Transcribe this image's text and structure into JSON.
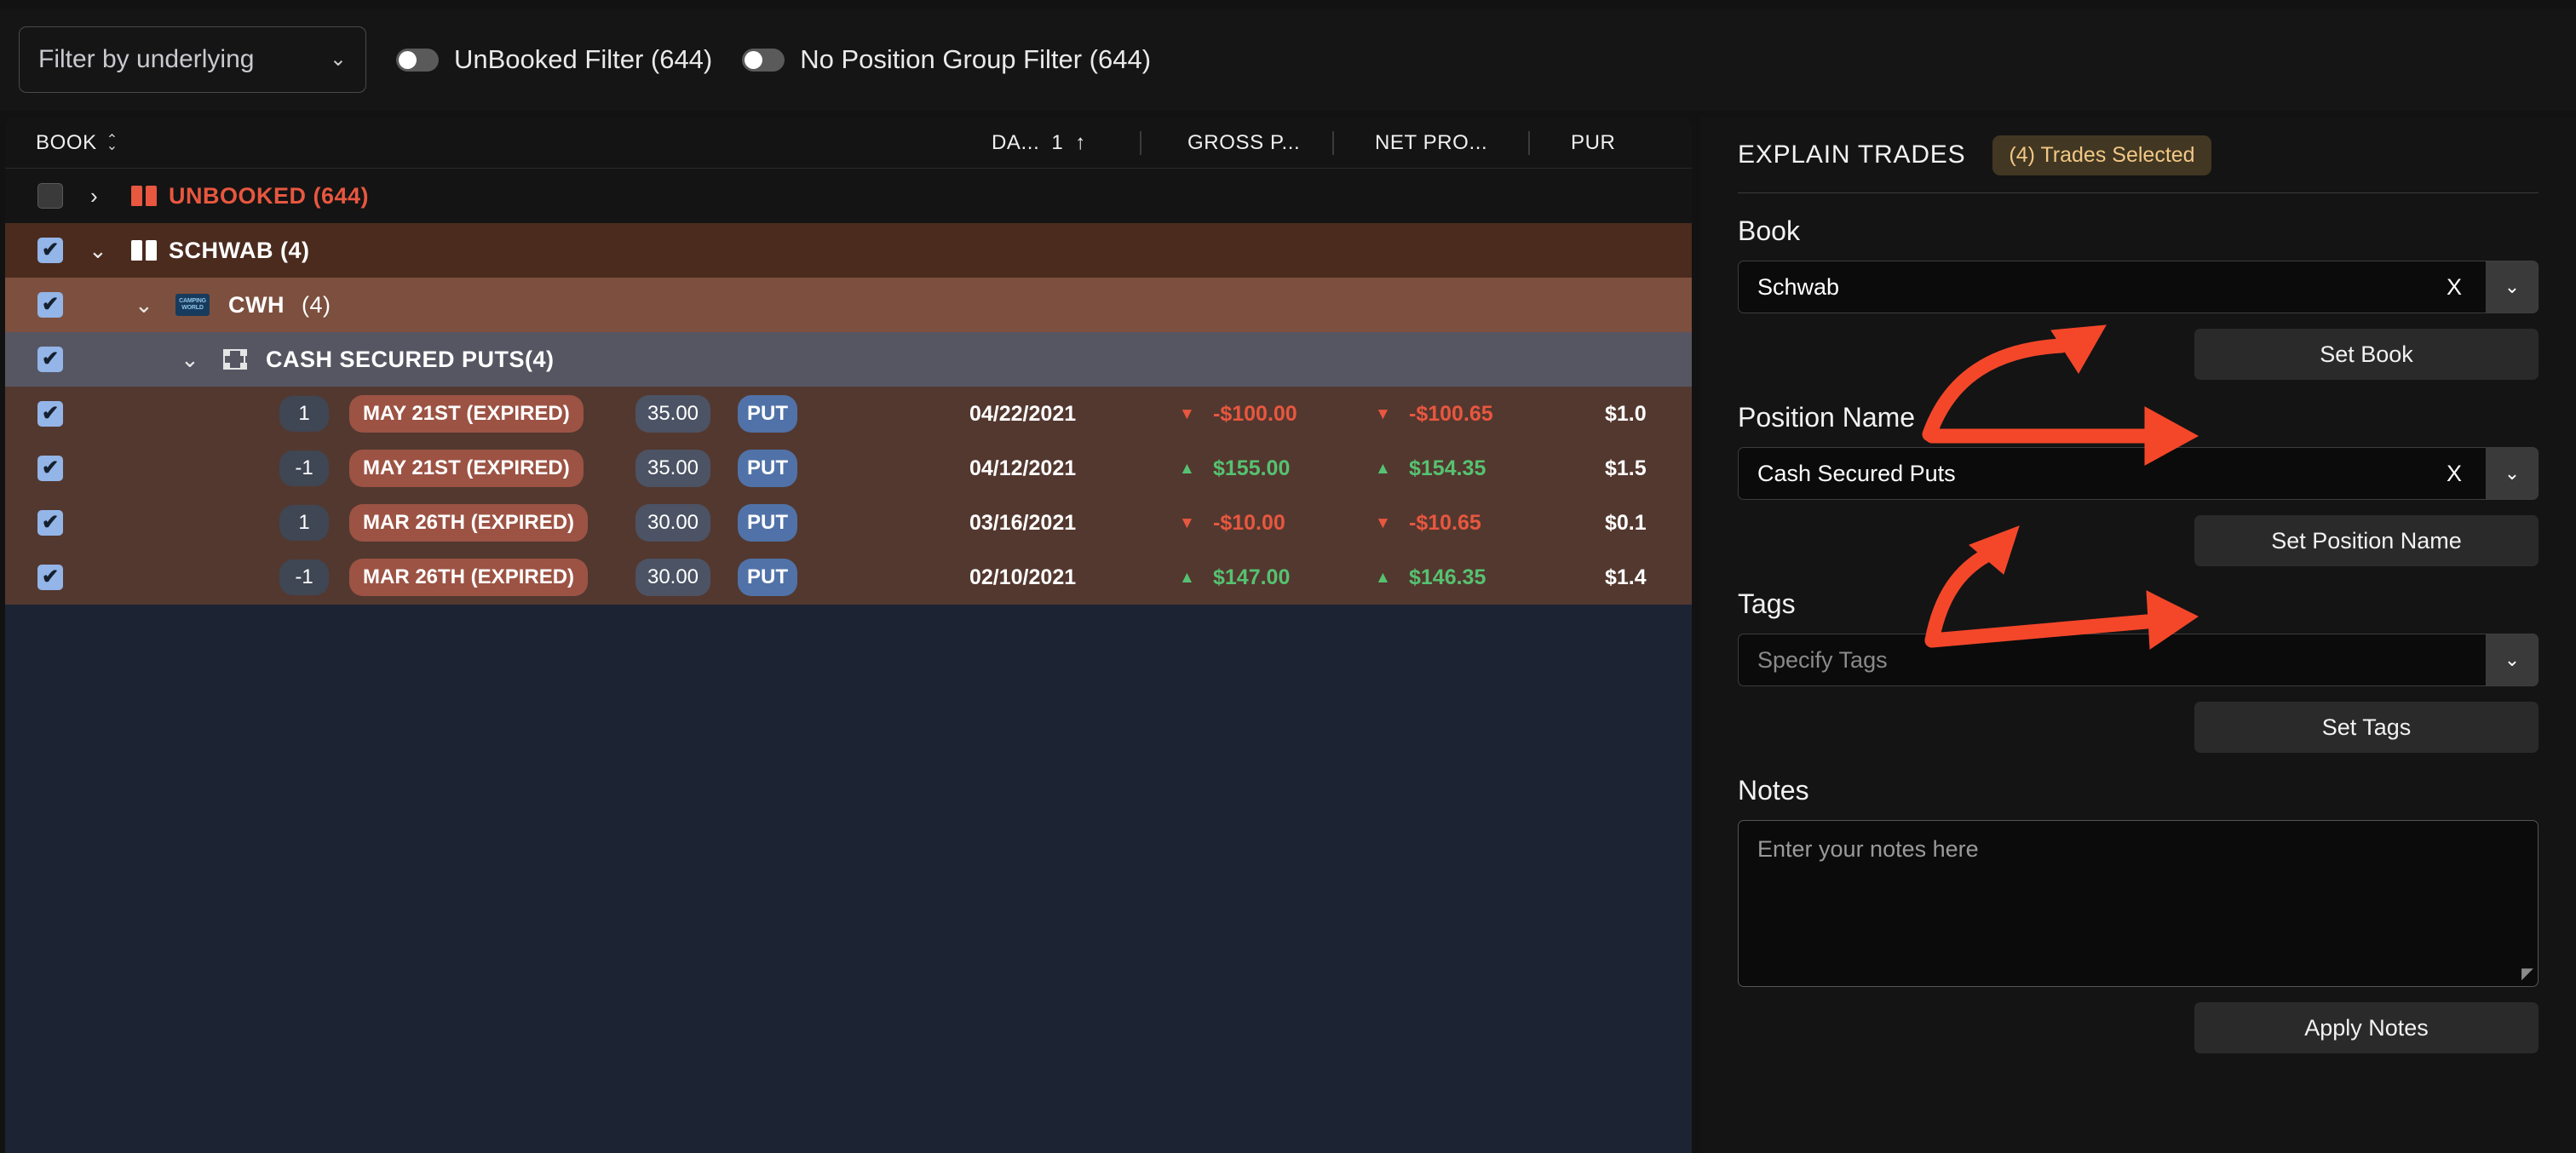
{
  "topbar": {
    "underlying_filter": {
      "label": "Filter by underlying",
      "chevron": "chevron-down-icon"
    },
    "toggles": [
      {
        "label": "UnBooked Filter (644)",
        "state": "off"
      },
      {
        "label": "No Position Group Filter (644)",
        "state": "off"
      }
    ]
  },
  "grid": {
    "columns": [
      {
        "key": "book",
        "label": "BOOK",
        "sort": "sortable"
      },
      {
        "key": "date",
        "label": "DA...",
        "sort_order": "1",
        "sort_dir": "↑"
      },
      {
        "key": "gross",
        "label": "GROSS P..."
      },
      {
        "key": "net",
        "label": "NET PRO..."
      },
      {
        "key": "pur",
        "label": "PUR"
      }
    ],
    "groups": [
      {
        "label": "UNBOOKED (644)",
        "checked": false,
        "expanded": false,
        "icon": "book-icon"
      },
      {
        "label": "SCHWAB (4)",
        "checked": true,
        "expanded": true,
        "icon": "book-icon"
      },
      {
        "label": "CWH",
        "count": "(4)",
        "checked": true,
        "expanded": true,
        "icon": "camping-world-logo"
      },
      {
        "label": "CASH SECURED PUTS(4)",
        "checked": true,
        "expanded": true,
        "icon": "position-group-icon"
      }
    ],
    "trades": [
      {
        "checked": true,
        "qty": "1",
        "expiration": "MAY 21ST (EXPIRED)",
        "strike": "35.00",
        "type": "PUT",
        "date": "04/22/2021",
        "gross": "-$100.00",
        "gross_dir": "down",
        "net": "-$100.65",
        "net_dir": "down",
        "pur": "$1.0"
      },
      {
        "checked": true,
        "qty": "-1",
        "expiration": "MAY 21ST (EXPIRED)",
        "strike": "35.00",
        "type": "PUT",
        "date": "04/12/2021",
        "gross": "$155.00",
        "gross_dir": "up",
        "net": "$154.35",
        "net_dir": "up",
        "pur": "$1.5"
      },
      {
        "checked": true,
        "qty": "1",
        "expiration": "MAR 26TH (EXPIRED)",
        "strike": "30.00",
        "type": "PUT",
        "date": "03/16/2021",
        "gross": "-$10.00",
        "gross_dir": "down",
        "net": "-$10.65",
        "net_dir": "down",
        "pur": "$0.1"
      },
      {
        "checked": true,
        "qty": "-1",
        "expiration": "MAR 26TH (EXPIRED)",
        "strike": "30.00",
        "type": "PUT",
        "date": "02/10/2021",
        "gross": "$147.00",
        "gross_dir": "up",
        "net": "$146.35",
        "net_dir": "up",
        "pur": "$1.4"
      }
    ]
  },
  "detail": {
    "title": "EXPLAIN TRADES",
    "selected_badge": "(4) Trades Selected",
    "book": {
      "label": "Book",
      "value": "Schwab",
      "clear": "X",
      "button": "Set Book"
    },
    "position_name": {
      "label": "Position Name",
      "value": "Cash Secured Puts",
      "clear": "X",
      "button": "Set Position Name"
    },
    "tags": {
      "label": "Tags",
      "placeholder": "Specify Tags",
      "button": "Set Tags"
    },
    "notes": {
      "label": "Notes",
      "placeholder": "Enter your notes here",
      "button": "Apply Notes"
    }
  },
  "colors": {
    "positive": "#56c271",
    "negative": "#e8573f",
    "annotation": "#f4472a",
    "badge_text": "#f2c786",
    "checkbox": "#93b5e8"
  }
}
